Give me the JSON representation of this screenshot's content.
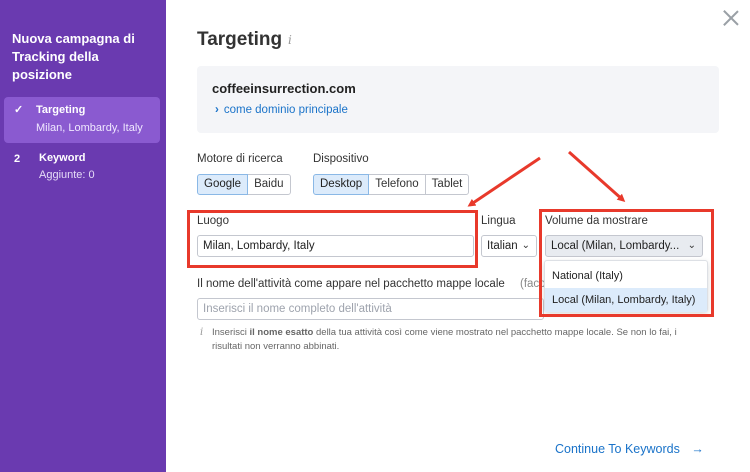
{
  "sidebar": {
    "title": "Nuova campagna di Tracking della posizione",
    "steps": [
      {
        "mark": "✓",
        "label": "Targeting",
        "sub": "Milan, Lombardy, Italy"
      },
      {
        "mark": "2",
        "label": "Keyword",
        "sub": "Aggiunte: 0"
      }
    ]
  },
  "header": {
    "title": "Targeting",
    "info_icon": "info-icon"
  },
  "domain": {
    "name": "coffeeinsurrection.com",
    "link": "come dominio principale"
  },
  "search_engine": {
    "label": "Motore di ricerca",
    "options": [
      "Google",
      "Baidu"
    ],
    "selected": "Google"
  },
  "device": {
    "label": "Dispositivo",
    "options": [
      "Desktop",
      "Telefono",
      "Tablet"
    ],
    "selected": "Desktop"
  },
  "location": {
    "label": "Luogo",
    "value": "Milan, Lombardy, Italy"
  },
  "language": {
    "label": "Lingua",
    "value": "Italian"
  },
  "volume": {
    "label": "Volume da mostrare",
    "value": "Local (Milan, Lombardy...",
    "options": [
      "National (Italy)",
      "Local (Milan, Lombardy, Italy)"
    ],
    "highlighted": "Local (Milan, Lombardy, Italy)"
  },
  "business": {
    "label": "Il nome dell'attività come appare nel pacchetto mappe locale",
    "optional": "(faco",
    "placeholder": "Inserisci il nome completo dell'attività"
  },
  "hint": {
    "before": "Inserisci ",
    "bold": "il nome esatto",
    "after": " della tua attività così come viene mostrato nel pacchetto mappe locale. Se non lo fai, i risultati non verranno abbinati."
  },
  "footer": {
    "continue_label": "Continue To Keywords",
    "arrow": "→"
  },
  "colors": {
    "sidebar": "#6a3ab0",
    "accent": "#1a73c9",
    "annotation": "#e8392b"
  }
}
